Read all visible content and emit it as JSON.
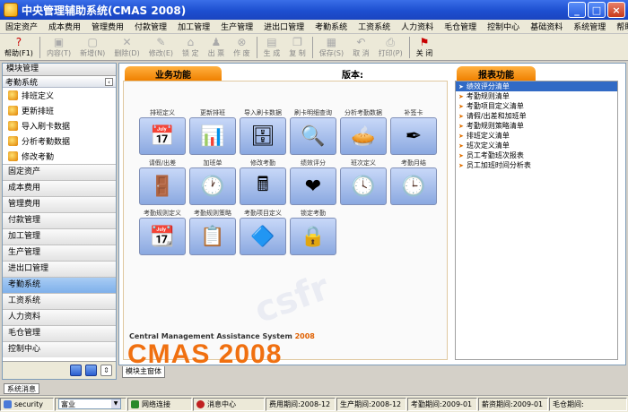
{
  "window": {
    "title": "中央管理辅助系统(CMAS 2008)"
  },
  "menu": [
    "固定资产",
    "成本费用",
    "管理费用",
    "付款管理",
    "加工管理",
    "生产管理",
    "进出口管理",
    "考勤系统",
    "工资系统",
    "人力资料",
    "毛仓管理",
    "控制中心",
    "基础资料",
    "系统管理",
    "帮助"
  ],
  "toolbar": [
    {
      "label": "帮助(F1)",
      "icon": "help-icon",
      "active": true
    },
    {
      "label": "内容(T)",
      "icon": "content-icon",
      "active": false
    },
    {
      "label": "新增(N)",
      "icon": "new-icon",
      "active": false
    },
    {
      "label": "删除(D)",
      "icon": "delete-icon",
      "active": false
    },
    {
      "label": "修改(E)",
      "icon": "edit-icon",
      "active": false
    },
    {
      "label": "锁 定",
      "icon": "lock-icon",
      "active": false
    },
    {
      "label": "出 票",
      "icon": "ticket-icon",
      "active": false
    },
    {
      "label": "作 废",
      "icon": "cancel-icon",
      "active": false
    },
    {
      "label": "生 成",
      "icon": "generate-icon",
      "active": false
    },
    {
      "label": "复 制",
      "icon": "copy-icon",
      "active": false
    },
    {
      "label": "保存(S)",
      "icon": "save-icon",
      "active": false
    },
    {
      "label": "取 消",
      "icon": "undo-icon",
      "active": false
    },
    {
      "label": "打印(P)",
      "icon": "print-icon",
      "active": false
    },
    {
      "label": "关 闭",
      "icon": "close-door-icon",
      "active": true
    }
  ],
  "left": {
    "header": "模块管理",
    "section": "考勤系统",
    "items": [
      "排班定义",
      "更新排班",
      "导入刷卡数据",
      "分析考勤数据",
      "修改考勤"
    ],
    "groups": [
      "固定资产",
      "成本费用",
      "管理费用",
      "付款管理",
      "加工管理",
      "生产管理",
      "进出口管理",
      "考勤系统",
      "工资系统",
      "人力资料",
      "毛仓管理",
      "控制中心"
    ],
    "selected_group": "考勤系统"
  },
  "main": {
    "func_tab": "业务功能",
    "version_label": "版本:",
    "report_tab": "报表功能",
    "functions": [
      {
        "label": "排班定义",
        "glyph": "📅"
      },
      {
        "label": "更新排班",
        "glyph": "📊"
      },
      {
        "label": "导入刷卡数据",
        "glyph": "🗄"
      },
      {
        "label": "刷卡明细查询",
        "glyph": "🔍"
      },
      {
        "label": "分析考勤数据",
        "glyph": "🥧"
      },
      {
        "label": "补签卡",
        "glyph": "✒"
      },
      {
        "label": "请假/出差",
        "glyph": "🚪"
      },
      {
        "label": "加班单",
        "glyph": "🕐"
      },
      {
        "label": "修改考勤",
        "glyph": "🖩"
      },
      {
        "label": "绩效评分",
        "glyph": "❤"
      },
      {
        "label": "班次定义",
        "glyph": "🕓"
      },
      {
        "label": "考勤月结",
        "glyph": "🕒"
      },
      {
        "label": "考勤规则定义",
        "glyph": "📆"
      },
      {
        "label": "考勤规则策略",
        "glyph": "📋"
      },
      {
        "label": "考勤项目定义",
        "glyph": "🔷"
      },
      {
        "label": "锁定考勤",
        "glyph": "🔒"
      }
    ],
    "reports": [
      "绩效评分清单",
      "考勤规则清单",
      "考勤项目定义清单",
      "请假/出差和加班单",
      "考勤规则策略清单",
      "排班定义清单",
      "班次定义清单",
      "员工考勤班次报表",
      "员工加班时间分析表"
    ],
    "selected_report": "绩效评分清单",
    "banner": {
      "subtitle": "Central Management Assistance System",
      "subtitle_year": "2008",
      "big": "CMAS 2008"
    },
    "bottom_tab": "模块主窗体"
  },
  "status": {
    "msg_tab": "系统消息",
    "user": "security",
    "dept": "富业",
    "network": "网络连接",
    "msg_center": "消息中心",
    "cost_period": "费用期间:2008-12",
    "prod_period": "生产期间:2008-12",
    "att_period": "考勤期间:2009-01",
    "pay_period": "薪资期间:2009-01",
    "wool": "毛仓期间:"
  },
  "colors": {
    "accent": "#f08000",
    "title_blue": "#1d4fd0",
    "selection": "#316ac5"
  }
}
